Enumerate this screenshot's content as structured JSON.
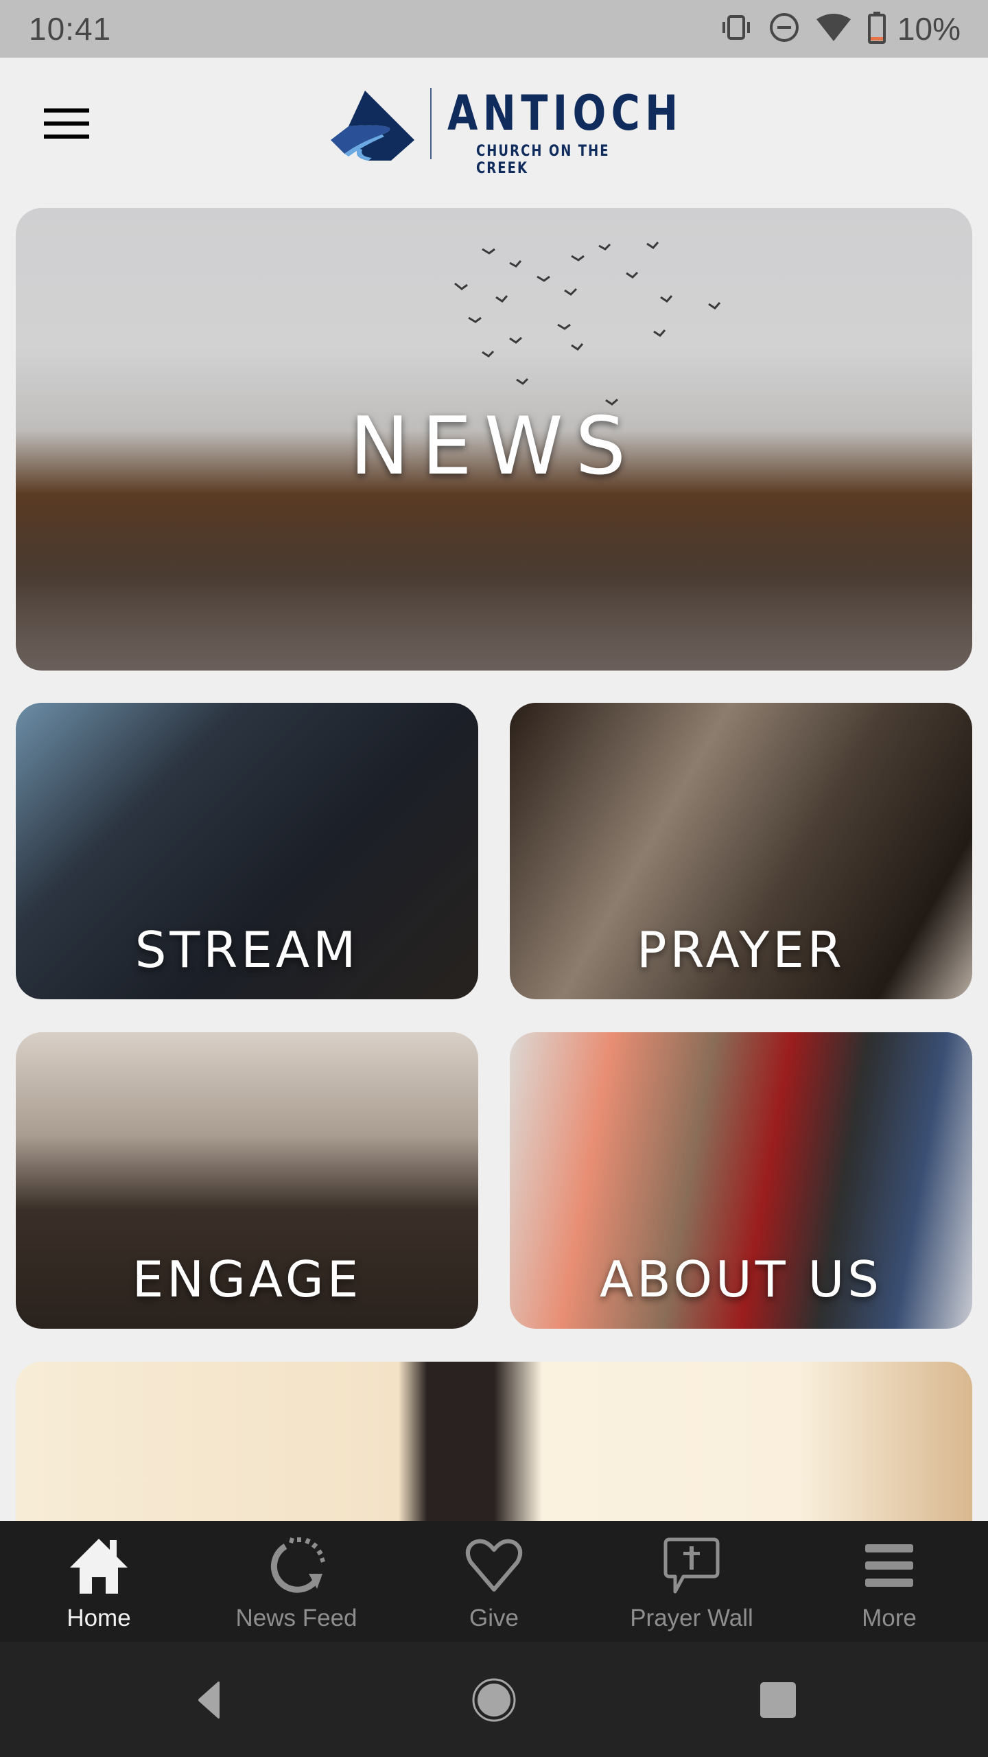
{
  "status_bar": {
    "time": "10:41",
    "battery_percent_label": "10%",
    "battery_level": 0.1,
    "icons": [
      "vibrate-icon",
      "do-not-disturb-icon",
      "wifi-icon",
      "battery-icon"
    ],
    "battery_low_color": "#e8734a"
  },
  "header": {
    "menu_icon": "hamburger-menu-icon",
    "logo": {
      "name": "ANTIOCH",
      "tagline": "CHURCH ON THE CREEK",
      "brand_color": "#0f2c5c",
      "accent_color": "#5b9bd8"
    }
  },
  "tiles": {
    "news": "NEWS",
    "stream": "STREAM",
    "prayer": "PRAYER",
    "engage": "ENGAGE",
    "about": "ABOUT US"
  },
  "bottom_nav": {
    "items": [
      {
        "label": "Home",
        "icon": "home-icon",
        "active": true
      },
      {
        "label": "News Feed",
        "icon": "refresh-icon",
        "active": false
      },
      {
        "label": "Give",
        "icon": "heart-icon",
        "active": false
      },
      {
        "label": "Prayer Wall",
        "icon": "prayer-chat-icon",
        "active": false
      },
      {
        "label": "More",
        "icon": "menu-icon",
        "active": false
      }
    ],
    "active_color": "#f2f2f2",
    "inactive_color": "#8e8e8e"
  },
  "system_nav": {
    "back": "back-icon",
    "home": "home-circle-icon",
    "recents": "recents-icon"
  }
}
